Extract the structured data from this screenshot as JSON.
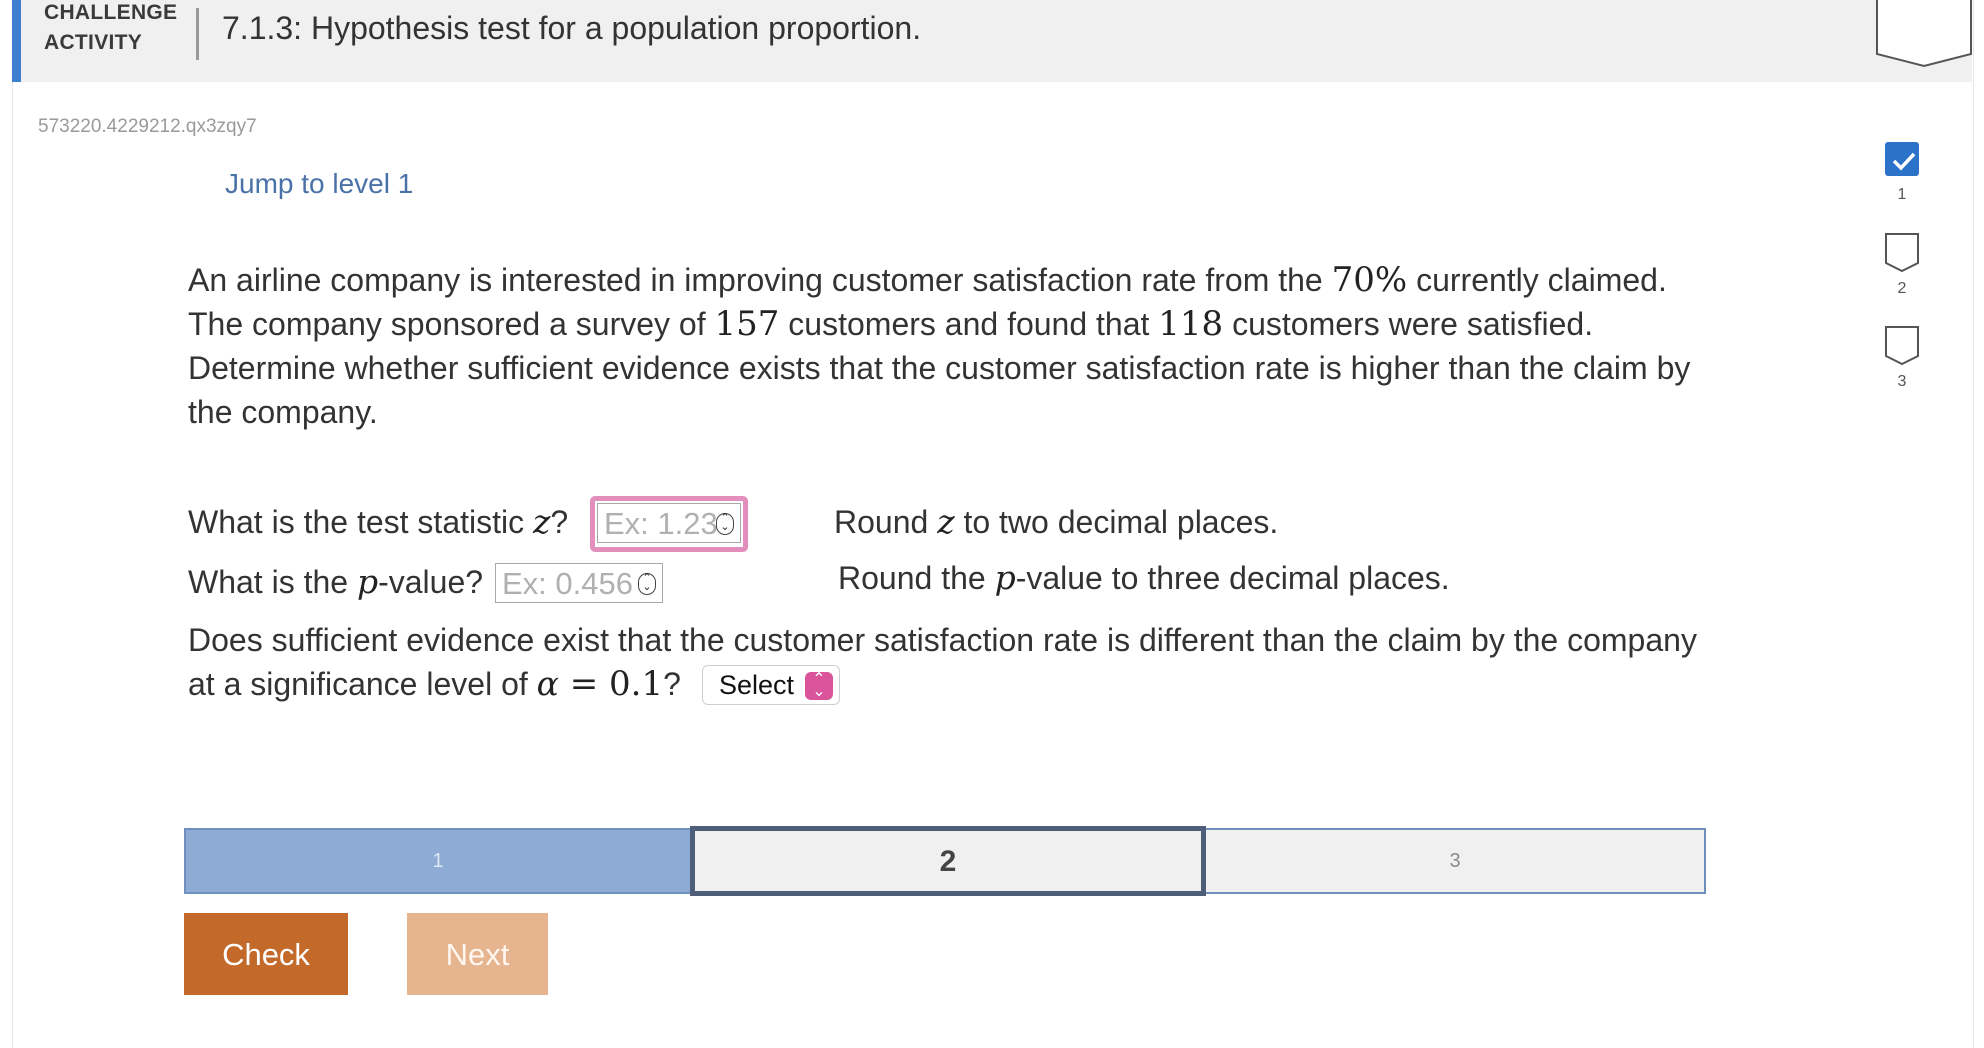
{
  "header": {
    "kind_line1": "CHALLENGE",
    "kind_line2": "ACTIVITY",
    "title": "7.1.3: Hypothesis test for a population proportion."
  },
  "activity_id": "573220.4229212.qx3zqy7",
  "jump_link": "Jump to level 1",
  "prompt": {
    "t1": "An airline company is interested in improving customer satisfaction rate from the ",
    "claimed_rate": "70%",
    "t2": " currently claimed.",
    "t3": "The company sponsored a survey of ",
    "sample_size": "157",
    "t4": " customers and found that ",
    "satisfied": "118",
    "t5": " customers were satisfied.",
    "t6": "Determine whether sufficient evidence exists that the customer satisfaction rate is higher than the claim by",
    "t7": "the company."
  },
  "questions": {
    "z_label_a": "What is the test statistic ",
    "z_var": "z",
    "z_label_b": "?",
    "z_placeholder": "Ex: 1.23",
    "z_hint_a": "Round ",
    "z_hint_var": "z",
    "z_hint_b": " to two decimal places.",
    "p_label_a": "What is the ",
    "p_var": "p",
    "p_label_b": "-value?",
    "p_placeholder": "Ex: 0.456",
    "p_hint_a": "Round the ",
    "p_hint_var": "p",
    "p_hint_b": "-value to three decimal places.",
    "evidence_line1": "Does sufficient evidence exist that the customer satisfaction rate is different than the claim by the company",
    "evidence_line2a": "at a significance level of ",
    "alpha_var": "α",
    "alpha_eq": " = 0.1",
    "evidence_q": "?",
    "select_label": "Select"
  },
  "levels": {
    "items": [
      "1",
      "2",
      "3"
    ],
    "current": "2"
  },
  "buttons": {
    "check": "Check",
    "next": "Next"
  },
  "side_levels": [
    {
      "num": "1",
      "completed": true
    },
    {
      "num": "2",
      "completed": false
    },
    {
      "num": "3",
      "completed": false
    }
  ],
  "colors": {
    "accent": "#3f7fcf",
    "check_button": "#c3692a",
    "next_button": "#e6b48e",
    "level_done": "#8dabd4",
    "focus_ring": "#e28fbe",
    "select_chevron": "#d9549a"
  }
}
